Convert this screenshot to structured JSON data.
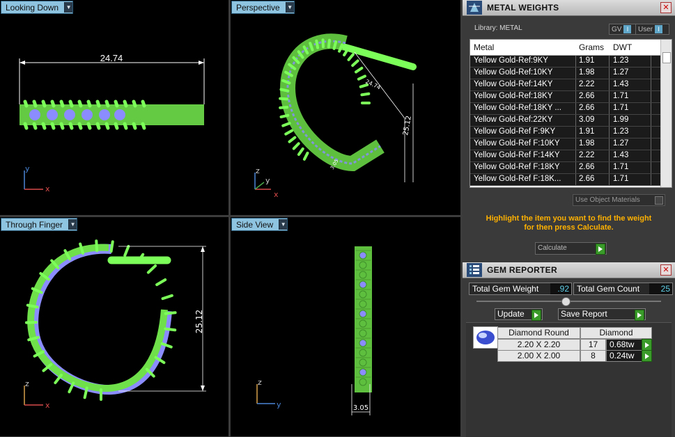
{
  "viewports": {
    "top_left": {
      "label": "Looking Down",
      "dimension": "24.74"
    },
    "top_right": {
      "label": "Perspective",
      "dim_a": "24.74",
      "dim_b": "25.12",
      "dim_c": "3.05"
    },
    "bottom_left": {
      "label": "Through Finger",
      "dimension": "25.12"
    },
    "bottom_right": {
      "label": "Side View",
      "dimension": "3.05"
    }
  },
  "axes": {
    "x": "x",
    "y": "y",
    "z": "z"
  },
  "metal_weights": {
    "title": "METAL WEIGHTS",
    "library_label": "Library: METAL",
    "gv_label": "GV",
    "user_label": "User",
    "columns": [
      "Metal",
      "Grams",
      "DWT"
    ],
    "rows": [
      {
        "metal": "Yellow Gold-Ref:9KY",
        "grams": "1.91",
        "dwt": "1.23"
      },
      {
        "metal": "Yellow Gold-Ref:10KY",
        "grams": "1.98",
        "dwt": "1.27"
      },
      {
        "metal": "Yellow Gold-Ref:14KY",
        "grams": "2.22",
        "dwt": "1.43"
      },
      {
        "metal": "Yellow Gold-Ref:18KY",
        "grams": "2.66",
        "dwt": "1.71"
      },
      {
        "metal": "Yellow Gold-Ref:18KY ...",
        "grams": "2.66",
        "dwt": "1.71"
      },
      {
        "metal": "Yellow Gold-Ref:22KY",
        "grams": "3.09",
        "dwt": "1.99"
      },
      {
        "metal": "Yellow Gold-Ref F:9KY",
        "grams": "1.91",
        "dwt": "1.23"
      },
      {
        "metal": "Yellow Gold-Ref F:10KY",
        "grams": "1.98",
        "dwt": "1.27"
      },
      {
        "metal": "Yellow Gold-Ref F:14KY",
        "grams": "2.22",
        "dwt": "1.43"
      },
      {
        "metal": "Yellow Gold-Ref F:18KY",
        "grams": "2.66",
        "dwt": "1.71"
      },
      {
        "metal": "Yellow Gold-Ref F:18K...",
        "grams": "2.66",
        "dwt": "1.71"
      }
    ],
    "use_object_materials": "Use Object Materials",
    "hint_line1": "Highlight the item you want to find the weight",
    "hint_line2": "for then press Calculate.",
    "calculate_label": "Calculate"
  },
  "gem_reporter": {
    "title": "GEM REPORTER",
    "total_weight_label": "Total Gem Weight",
    "total_weight_value": ".92",
    "total_count_label": "Total Gem Count",
    "total_count_value": "25",
    "update_label": "Update",
    "save_report_label": "Save Report",
    "col_shape": "Diamond Round",
    "col_type": "Diamond",
    "rows": [
      {
        "size": "2.20 X 2.20",
        "count": "17",
        "tw": "0.68tw"
      },
      {
        "size": "2.00 X 2.00",
        "count": "8",
        "tw": "0.24tw"
      }
    ]
  },
  "colors": {
    "viewport_bg": "#000000",
    "label_bg": "#8fc4e0",
    "wire_green": "#7dff5a",
    "wire_blue": "#8a8cff",
    "hint_orange": "#ffb100"
  }
}
